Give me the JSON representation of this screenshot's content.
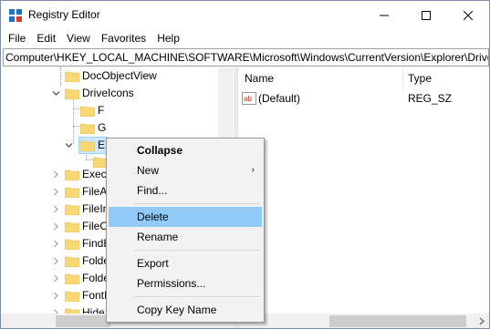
{
  "window": {
    "title": "Registry Editor",
    "app_icon": "registry-editor-icon"
  },
  "menubar": [
    "File",
    "Edit",
    "View",
    "Favorites",
    "Help"
  ],
  "address": {
    "path": "Computer\\HKEY_LOCAL_MACHINE\\SOFTWARE\\Microsoft\\Windows\\CurrentVersion\\Explorer\\DriveIcons"
  },
  "tree": {
    "items": [
      {
        "label": "DocObjectView"
      },
      {
        "label": "DriveIcons"
      },
      {
        "label": "F"
      },
      {
        "label": "G"
      },
      {
        "label": "E"
      },
      {
        "label": ""
      },
      {
        "label": "Execu"
      },
      {
        "label": "FileA"
      },
      {
        "label": "FileIn"
      },
      {
        "label": "FileC"
      },
      {
        "label": "FindE"
      },
      {
        "label": "Folde"
      },
      {
        "label": "Folde"
      },
      {
        "label": "FontI"
      },
      {
        "label": "Hide"
      }
    ]
  },
  "list": {
    "columns": [
      "Name",
      "Type"
    ],
    "rows": [
      {
        "name": "(Default)",
        "type": "REG_SZ",
        "icon": "reg-string-icon"
      }
    ]
  },
  "context_menu": {
    "items": [
      {
        "label": "Collapse",
        "bold": true
      },
      {
        "label": "New",
        "submenu": true
      },
      {
        "label": "Find..."
      },
      {
        "label": "Delete",
        "highlighted": true
      },
      {
        "label": "Rename"
      },
      {
        "label": "Export"
      },
      {
        "label": "Permissions..."
      },
      {
        "label": "Copy Key Name"
      }
    ]
  },
  "colors": {
    "highlight": "#91c9f7",
    "folder": "#f8d775",
    "selection": "#cce8ff"
  }
}
